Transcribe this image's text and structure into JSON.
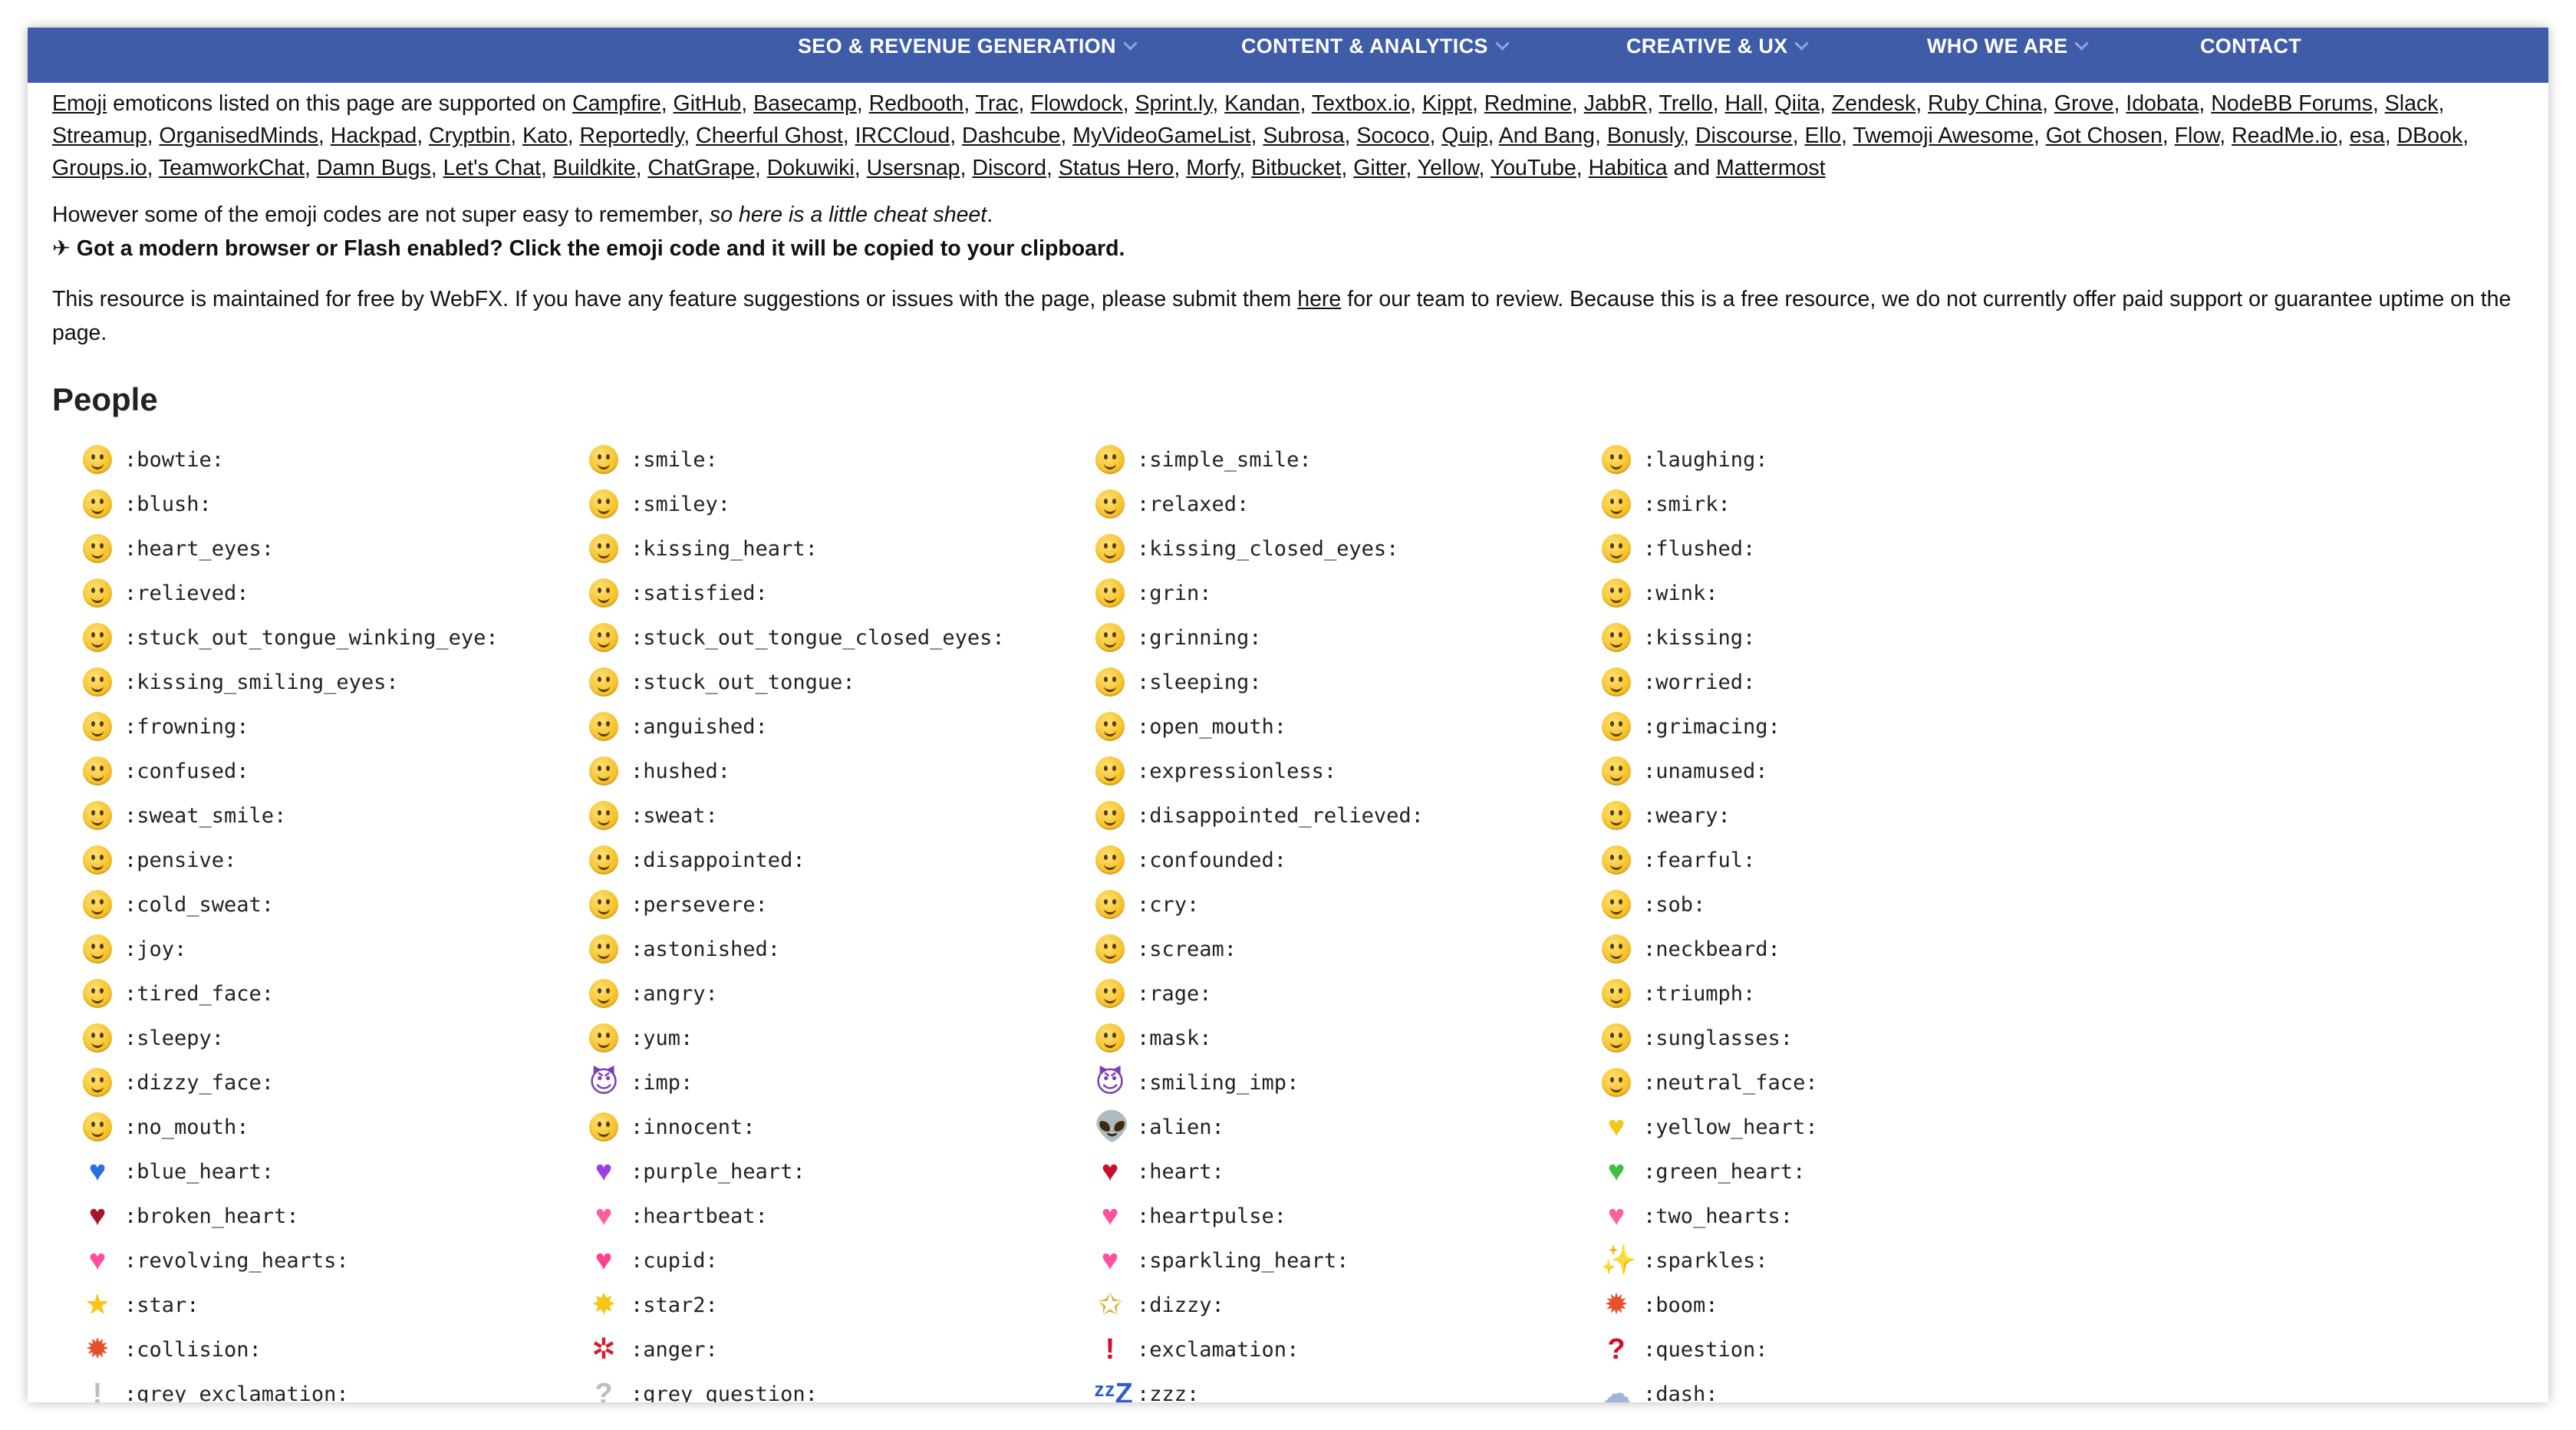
{
  "nav": {
    "items": [
      {
        "label": "SEO & REVENUE GENERATION",
        "dropdown": true
      },
      {
        "label": "CONTENT & ANALYTICS",
        "dropdown": true
      },
      {
        "label": "CREATIVE & UX",
        "dropdown": true
      },
      {
        "label": "WHO WE ARE",
        "dropdown": true
      },
      {
        "label": "CONTACT",
        "dropdown": false
      }
    ],
    "background": "#3f5ca8"
  },
  "intro": {
    "emoji_link": "Emoji",
    "lead": " emoticons listed on this page are supported on ",
    "services": [
      "Campfire",
      "GitHub",
      "Basecamp",
      "Redbooth",
      "Trac",
      "Flowdock",
      "Sprint.ly",
      "Kandan",
      "Textbox.io",
      "Kippt",
      "Redmine",
      "JabbR",
      "Trello",
      "Hall",
      "Qiita",
      "Zendesk",
      "Ruby China",
      "Grove",
      "Idobata",
      "NodeBB Forums",
      "Slack",
      "Streamup",
      "OrganisedMinds",
      "Hackpad",
      "Cryptbin",
      "Kato",
      "Reportedly",
      "Cheerful Ghost",
      "IRCCloud",
      "Dashcube",
      "MyVideoGameList",
      "Subrosa",
      "Sococo",
      "Quip",
      "And Bang",
      "Bonusly",
      "Discourse",
      "Ello",
      "Twemoji Awesome",
      "Got Chosen",
      "Flow",
      "ReadMe.io",
      "esa",
      "DBook",
      "Groups.io",
      "TeamworkChat",
      "Damn Bugs",
      "Let's Chat",
      "Buildkite",
      "ChatGrape",
      "Dokuwiki",
      "Usersnap",
      "Discord",
      "Status Hero",
      "Morfy",
      "Bitbucket",
      "Gitter",
      "Yellow",
      "YouTube",
      "Habitica"
    ],
    "and_word": " and ",
    "last_service": "Mattermost",
    "cheat_prefix": "However some of the emoji codes are not super easy to remember, ",
    "cheat_italic": "so here is a little cheat sheet",
    "cheat_suffix": ".",
    "clipboard_note": "✈ Got a modern browser or Flash enabled? Click the emoji code and it will be copied to your clipboard.",
    "maintained_prefix": "This resource is maintained for free by WebFX. If you have any feature suggestions or issues with the page, please submit them ",
    "maintained_link": "here",
    "maintained_suffix": " for our team to review. Because this is a free resource, we do not currently offer paid support or guarantee uptime on the page."
  },
  "section": {
    "title": "People",
    "emojis": [
      {
        "code": ":bowtie:",
        "icon": "bowtie-icon",
        "kind": "face"
      },
      {
        "code": ":smile:",
        "icon": "smile-icon",
        "kind": "face"
      },
      {
        "code": ":simple_smile:",
        "icon": "simple-smile-icon",
        "kind": "face"
      },
      {
        "code": ":laughing:",
        "icon": "laughing-icon",
        "kind": "face"
      },
      {
        "code": ":blush:",
        "icon": "blush-icon",
        "kind": "face"
      },
      {
        "code": ":smiley:",
        "icon": "smiley-icon",
        "kind": "face"
      },
      {
        "code": ":relaxed:",
        "icon": "relaxed-icon",
        "kind": "face"
      },
      {
        "code": ":smirk:",
        "icon": "smirk-icon",
        "kind": "face"
      },
      {
        "code": ":heart_eyes:",
        "icon": "heart-eyes-icon",
        "kind": "face"
      },
      {
        "code": ":kissing_heart:",
        "icon": "kissing-heart-icon",
        "kind": "face"
      },
      {
        "code": ":kissing_closed_eyes:",
        "icon": "kissing-closed-eyes-icon",
        "kind": "face"
      },
      {
        "code": ":flushed:",
        "icon": "flushed-icon",
        "kind": "face"
      },
      {
        "code": ":relieved:",
        "icon": "relieved-icon",
        "kind": "face"
      },
      {
        "code": ":satisfied:",
        "icon": "satisfied-icon",
        "kind": "face"
      },
      {
        "code": ":grin:",
        "icon": "grin-icon",
        "kind": "face"
      },
      {
        "code": ":wink:",
        "icon": "wink-icon",
        "kind": "face"
      },
      {
        "code": ":stuck_out_tongue_winking_eye:",
        "icon": "stuck-out-tongue-winking-eye-icon",
        "kind": "face"
      },
      {
        "code": ":stuck_out_tongue_closed_eyes:",
        "icon": "stuck-out-tongue-closed-eyes-icon",
        "kind": "face"
      },
      {
        "code": ":grinning:",
        "icon": "grinning-icon",
        "kind": "face"
      },
      {
        "code": ":kissing:",
        "icon": "kissing-icon",
        "kind": "face"
      },
      {
        "code": ":kissing_smiling_eyes:",
        "icon": "kissing-smiling-eyes-icon",
        "kind": "face"
      },
      {
        "code": ":stuck_out_tongue:",
        "icon": "stuck-out-tongue-icon",
        "kind": "face"
      },
      {
        "code": ":sleeping:",
        "icon": "sleeping-icon",
        "kind": "face"
      },
      {
        "code": ":worried:",
        "icon": "worried-icon",
        "kind": "face"
      },
      {
        "code": ":frowning:",
        "icon": "frowning-icon",
        "kind": "face"
      },
      {
        "code": ":anguished:",
        "icon": "anguished-icon",
        "kind": "face"
      },
      {
        "code": ":open_mouth:",
        "icon": "open-mouth-icon",
        "kind": "face"
      },
      {
        "code": ":grimacing:",
        "icon": "grimacing-icon",
        "kind": "face"
      },
      {
        "code": ":confused:",
        "icon": "confused-icon",
        "kind": "face"
      },
      {
        "code": ":hushed:",
        "icon": "hushed-icon",
        "kind": "face"
      },
      {
        "code": ":expressionless:",
        "icon": "expressionless-icon",
        "kind": "face"
      },
      {
        "code": ":unamused:",
        "icon": "unamused-icon",
        "kind": "face"
      },
      {
        "code": ":sweat_smile:",
        "icon": "sweat-smile-icon",
        "kind": "face"
      },
      {
        "code": ":sweat:",
        "icon": "sweat-icon",
        "kind": "face"
      },
      {
        "code": ":disappointed_relieved:",
        "icon": "disappointed-relieved-icon",
        "kind": "face"
      },
      {
        "code": ":weary:",
        "icon": "weary-icon",
        "kind": "face"
      },
      {
        "code": ":pensive:",
        "icon": "pensive-icon",
        "kind": "face"
      },
      {
        "code": ":disappointed:",
        "icon": "disappointed-icon",
        "kind": "face"
      },
      {
        "code": ":confounded:",
        "icon": "confounded-icon",
        "kind": "face"
      },
      {
        "code": ":fearful:",
        "icon": "fearful-icon",
        "kind": "face"
      },
      {
        "code": ":cold_sweat:",
        "icon": "cold-sweat-icon",
        "kind": "face"
      },
      {
        "code": ":persevere:",
        "icon": "persevere-icon",
        "kind": "face"
      },
      {
        "code": ":cry:",
        "icon": "cry-icon",
        "kind": "face"
      },
      {
        "code": ":sob:",
        "icon": "sob-icon",
        "kind": "face"
      },
      {
        "code": ":joy:",
        "icon": "joy-icon",
        "kind": "face"
      },
      {
        "code": ":astonished:",
        "icon": "astonished-icon",
        "kind": "face"
      },
      {
        "code": ":scream:",
        "icon": "scream-icon",
        "kind": "face"
      },
      {
        "code": ":neckbeard:",
        "icon": "neckbeard-icon",
        "kind": "face"
      },
      {
        "code": ":tired_face:",
        "icon": "tired-face-icon",
        "kind": "face"
      },
      {
        "code": ":angry:",
        "icon": "angry-icon",
        "kind": "face"
      },
      {
        "code": ":rage:",
        "icon": "rage-icon",
        "kind": "face"
      },
      {
        "code": ":triumph:",
        "icon": "triumph-icon",
        "kind": "face"
      },
      {
        "code": ":sleepy:",
        "icon": "sleepy-icon",
        "kind": "face"
      },
      {
        "code": ":yum:",
        "icon": "yum-icon",
        "kind": "face"
      },
      {
        "code": ":mask:",
        "icon": "mask-icon",
        "kind": "face"
      },
      {
        "code": ":sunglasses:",
        "icon": "sunglasses-icon",
        "kind": "face"
      },
      {
        "code": ":dizzy_face:",
        "icon": "dizzy-face-icon",
        "kind": "face"
      },
      {
        "code": ":imp:",
        "icon": "imp-icon",
        "kind": "glyph",
        "glyph": "😈",
        "color": "#7b3fb0"
      },
      {
        "code": ":smiling_imp:",
        "icon": "smiling-imp-icon",
        "kind": "glyph",
        "glyph": "😈",
        "color": "#7b3fb0"
      },
      {
        "code": ":neutral_face:",
        "icon": "neutral-face-icon",
        "kind": "face"
      },
      {
        "code": ":no_mouth:",
        "icon": "no-mouth-icon",
        "kind": "face"
      },
      {
        "code": ":innocent:",
        "icon": "innocent-icon",
        "kind": "face"
      },
      {
        "code": ":alien:",
        "icon": "alien-icon",
        "kind": "glyph",
        "glyph": "👽",
        "color": "#8a9a9a"
      },
      {
        "code": ":yellow_heart:",
        "icon": "yellow-heart-icon",
        "kind": "glyph",
        "glyph": "♥",
        "color": "#f5c518"
      },
      {
        "code": ":blue_heart:",
        "icon": "blue-heart-icon",
        "kind": "glyph",
        "glyph": "♥",
        "color": "#2a6ee0"
      },
      {
        "code": ":purple_heart:",
        "icon": "purple-heart-icon",
        "kind": "glyph",
        "glyph": "♥",
        "color": "#9b3fe0"
      },
      {
        "code": ":heart:",
        "icon": "heart-icon",
        "kind": "glyph",
        "glyph": "♥",
        "color": "#c8102e"
      },
      {
        "code": ":green_heart:",
        "icon": "green-heart-icon",
        "kind": "glyph",
        "glyph": "♥",
        "color": "#3fbf3f"
      },
      {
        "code": ":broken_heart:",
        "icon": "broken-heart-icon",
        "kind": "glyph",
        "glyph": "♥",
        "color": "#a8142a"
      },
      {
        "code": ":heartbeat:",
        "icon": "heartbeat-icon",
        "kind": "glyph",
        "glyph": "♥",
        "color": "#ff5fa2"
      },
      {
        "code": ":heartpulse:",
        "icon": "heartpulse-icon",
        "kind": "glyph",
        "glyph": "♥",
        "color": "#ff4f9f"
      },
      {
        "code": ":two_hearts:",
        "icon": "two-hearts-icon",
        "kind": "glyph",
        "glyph": "♥",
        "color": "#ff5fa2"
      },
      {
        "code": ":revolving_hearts:",
        "icon": "revolving-hearts-icon",
        "kind": "glyph",
        "glyph": "♥",
        "color": "#ff4f9f"
      },
      {
        "code": ":cupid:",
        "icon": "cupid-icon",
        "kind": "glyph",
        "glyph": "♥",
        "color": "#ff3f8f"
      },
      {
        "code": ":sparkling_heart:",
        "icon": "sparkling-heart-icon",
        "kind": "glyph",
        "glyph": "♥",
        "color": "#ff4f9f"
      },
      {
        "code": ":sparkles:",
        "icon": "sparkles-icon",
        "kind": "glyph",
        "glyph": "✨",
        "color": "#f5c518"
      },
      {
        "code": ":star:",
        "icon": "star-icon",
        "kind": "glyph",
        "glyph": "★",
        "color": "#f5c518"
      },
      {
        "code": ":star2:",
        "icon": "star2-icon",
        "kind": "glyph",
        "glyph": "✸",
        "color": "#f5c518"
      },
      {
        "code": ":dizzy:",
        "icon": "dizzy-icon",
        "kind": "glyph",
        "glyph": "✩",
        "color": "#e0a020"
      },
      {
        "code": ":boom:",
        "icon": "boom-icon",
        "kind": "glyph",
        "glyph": "✹",
        "color": "#e8502a"
      },
      {
        "code": ":collision:",
        "icon": "collision-icon",
        "kind": "glyph",
        "glyph": "✹",
        "color": "#e8502a"
      },
      {
        "code": ":anger:",
        "icon": "anger-icon",
        "kind": "glyph",
        "glyph": "✲",
        "color": "#d02030"
      },
      {
        "code": ":exclamation:",
        "icon": "exclamation-icon",
        "kind": "glyph",
        "glyph": "!",
        "color": "#d0102a"
      },
      {
        "code": ":question:",
        "icon": "question-icon",
        "kind": "glyph",
        "glyph": "?",
        "color": "#d0102a"
      },
      {
        "code": ":grey_exclamation:",
        "icon": "grey-exclamation-icon",
        "kind": "glyph",
        "glyph": "!",
        "color": "#bdbdbd"
      },
      {
        "code": ":grey_question:",
        "icon": "grey-question-icon",
        "kind": "glyph",
        "glyph": "?",
        "color": "#bdbdbd"
      },
      {
        "code": ":zzz:",
        "icon": "zzz-icon",
        "kind": "glyph",
        "glyph": "ᶻᶻZ",
        "color": "#2a5fd0"
      },
      {
        "code": ":dash:",
        "icon": "dash-icon",
        "kind": "glyph",
        "glyph": "☁",
        "color": "#9fb6d8"
      }
    ]
  }
}
